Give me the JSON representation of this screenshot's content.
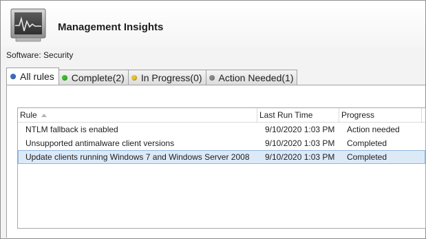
{
  "header": {
    "title": "Management Insights",
    "subtitle": "Software: Security",
    "icon": "performance-monitor-icon"
  },
  "tabs": [
    {
      "label": "All rules",
      "dot_color": "#3a6fc4",
      "active": true
    },
    {
      "label": "Complete(2)",
      "dot_color": "#3cba2c",
      "active": false
    },
    {
      "label": "In Progress(0)",
      "dot_color": "#e8c12e",
      "active": false
    },
    {
      "label": "Action Needed(1)",
      "dot_color": "#8a8a8a",
      "active": false
    }
  ],
  "grid": {
    "columns": [
      "Rule",
      "Last Run Time",
      "Progress"
    ],
    "sort_column": "Rule",
    "sort_direction": "ascending",
    "rows": [
      {
        "rule": "NTLM fallback is enabled",
        "time": "9/10/2020 1:03 PM",
        "progress": "Action needed",
        "selected": false
      },
      {
        "rule": "Unsupported antimalware client versions",
        "time": "9/10/2020 1:03 PM",
        "progress": "Completed",
        "selected": false
      },
      {
        "rule": "Update clients running Windows 7 and Windows Server 2008",
        "time": "9/10/2020 1:03 PM",
        "progress": "Completed",
        "selected": true
      }
    ]
  },
  "colors": {
    "selected_row": "#dceaf8",
    "selected_border": "#8fb5de"
  }
}
